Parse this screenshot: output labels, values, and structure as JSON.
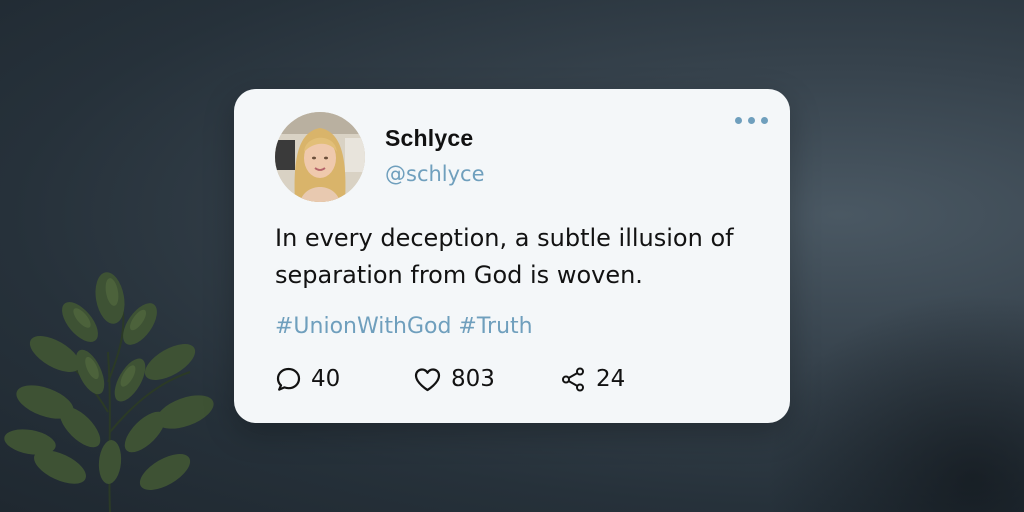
{
  "post": {
    "author": {
      "display_name": "Schlyce",
      "handle": "@schlyce",
      "avatar": "profile-photo"
    },
    "text": "In every deception, a subtle illusion of separation from God is woven.",
    "hashtags": [
      "#UnionWithGod",
      "#Truth"
    ],
    "stats": {
      "comments": "40",
      "likes": "803",
      "shares": "24"
    },
    "icons": {
      "more": "more-horizontal-icon",
      "comment": "comment-bubble-icon",
      "like": "heart-icon",
      "share": "share-icon"
    }
  },
  "colors": {
    "accent": "#6f9fbd",
    "card_background": "#f4f7f9",
    "text": "#121212",
    "page_background": "#2a353e"
  }
}
